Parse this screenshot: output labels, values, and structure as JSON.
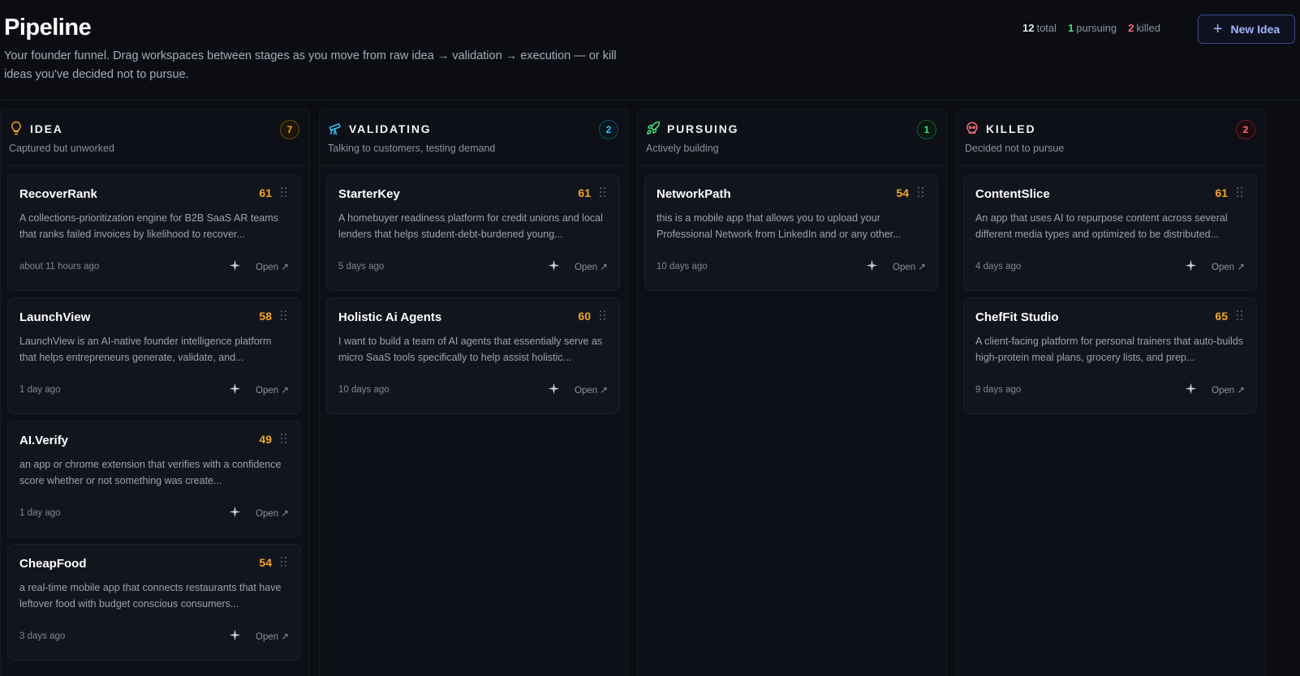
{
  "header": {
    "title": "Pipeline",
    "subtitle": "Your founder funnel. Drag workspaces between stages as you move from raw idea → validation → execution — or kill ideas you've decided not to pursue.",
    "stats": {
      "total_count": "12",
      "total_label": "total",
      "pursuing_count": "1",
      "pursuing_label": "pursuing",
      "killed_count": "2",
      "killed_label": "killed"
    },
    "new_button_label": "New Idea"
  },
  "columns": [
    {
      "key": "idea",
      "title": "IDEA",
      "description": "Captured but unworked",
      "count": "7",
      "icon": "lightbulb-icon",
      "color": "#f5a524",
      "cards": [
        {
          "title": "RecoverRank",
          "score": "61",
          "description": "A collections-prioritization engine for B2B SaaS AR teams that ranks failed invoices by likelihood to recover...",
          "time": "about 11 hours ago",
          "open_label": "Open ↗"
        },
        {
          "title": "LaunchView",
          "score": "58",
          "description": "LaunchView is an AI-native founder intelligence platform that helps entrepreneurs generate, validate, and...",
          "time": "1 day ago",
          "open_label": "Open ↗"
        },
        {
          "title": "AI.Verify",
          "score": "49",
          "description": "an app or chrome extension that verifies with a confidence score whether or not something was create...",
          "time": "1 day ago",
          "open_label": "Open ↗"
        },
        {
          "title": "CheapFood",
          "score": "54",
          "description": "a real-time mobile app that connects restaurants that have leftover food with budget conscious consumers...",
          "time": "3 days ago",
          "open_label": "Open ↗"
        }
      ]
    },
    {
      "key": "validating",
      "title": "VALIDATING",
      "description": "Talking to customers, testing demand",
      "count": "2",
      "icon": "telescope-icon",
      "color": "#38bdf8",
      "cards": [
        {
          "title": "StarterKey",
          "score": "61",
          "description": "A homebuyer readiness platform for credit unions and local lenders that helps student-debt-burdened young...",
          "time": "5 days ago",
          "open_label": "Open ↗"
        },
        {
          "title": "Holistic Ai Agents",
          "score": "60",
          "description": "I want to build a team of AI agents that essentially serve as micro SaaS tools specifically to help assist holistic...",
          "time": "10 days ago",
          "open_label": "Open ↗"
        }
      ]
    },
    {
      "key": "pursuing",
      "title": "PURSUING",
      "description": "Actively building",
      "count": "1",
      "icon": "rocket-icon",
      "color": "#4ade80",
      "cards": [
        {
          "title": "NetworkPath",
          "score": "54",
          "description": "this is a mobile app that allows you to upload your Professional Network from LinkedIn and or any other...",
          "time": "10 days ago",
          "open_label": "Open ↗"
        }
      ]
    },
    {
      "key": "killed",
      "title": "KILLED",
      "description": "Decided not to pursue",
      "count": "2",
      "icon": "skull-icon",
      "color": "#f87171",
      "cards": [
        {
          "title": "ContentSlice",
          "score": "61",
          "description": "An app that uses AI to repurpose content across several different media types and optimized to be distributed...",
          "time": "4 days ago",
          "open_label": "Open ↗"
        },
        {
          "title": "ChefFit Studio",
          "score": "65",
          "description": "A client-facing platform for personal trainers that auto-builds high-protein meal plans, grocery lists, and prep...",
          "time": "9 days ago",
          "open_label": "Open ↗"
        }
      ]
    }
  ]
}
